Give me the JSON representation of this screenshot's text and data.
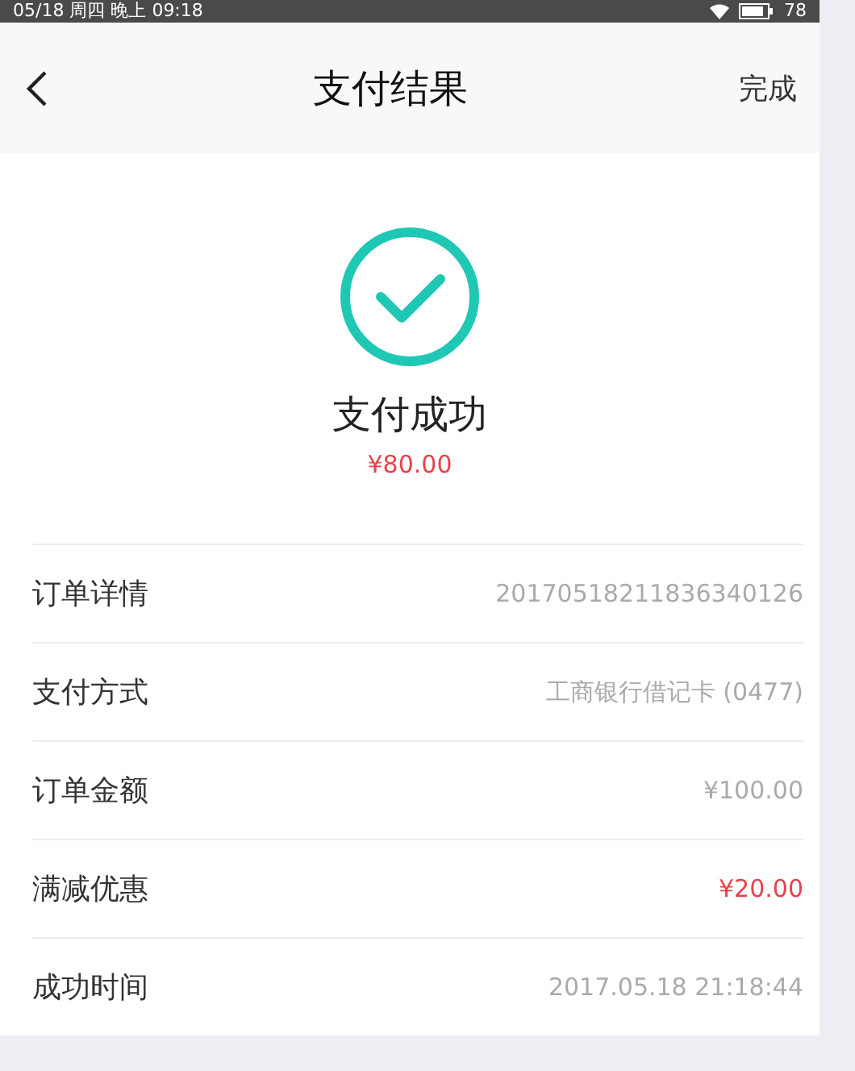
{
  "status_bar": {
    "time": "05/18 周四 晚上 09:18",
    "battery": "78"
  },
  "nav": {
    "title": "支付结果",
    "action": "完成"
  },
  "result": {
    "status": "支付成功",
    "amount": "¥80.00"
  },
  "details": [
    {
      "label": "订单详情",
      "value": "20170518211836340126",
      "highlight": false
    },
    {
      "label": "支付方式",
      "value": "工商银行借记卡 (0477)",
      "highlight": false
    },
    {
      "label": "订单金额",
      "value": "¥100.00",
      "highlight": false
    },
    {
      "label": "满减优惠",
      "value": "¥20.00",
      "highlight": true
    },
    {
      "label": "成功时间",
      "value": "2017.05.18 21:18:44",
      "highlight": false
    }
  ]
}
